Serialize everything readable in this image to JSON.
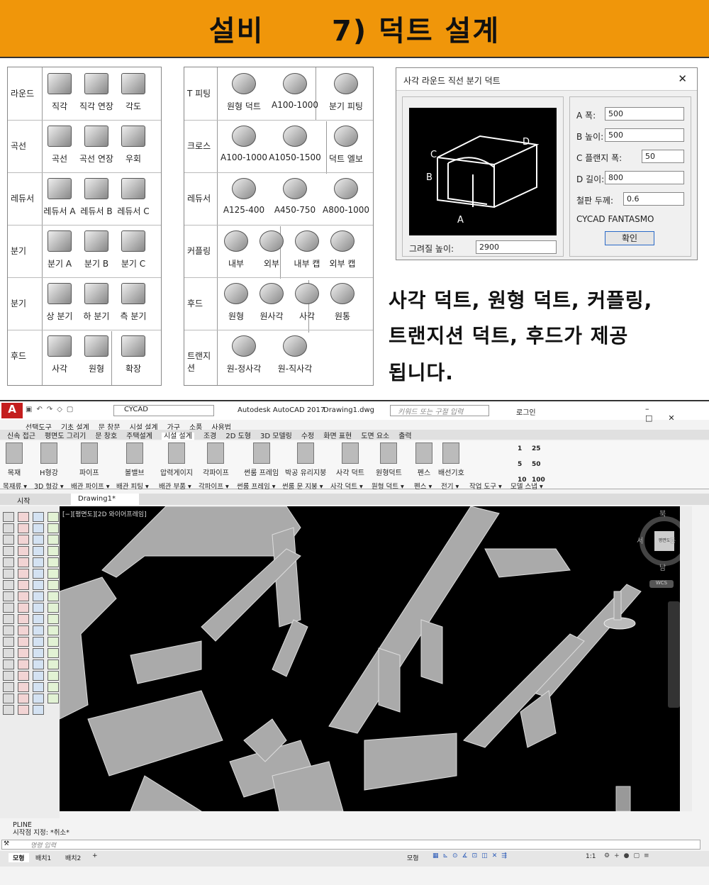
{
  "banner": {
    "title": "설비      7) 덕트 설계"
  },
  "left_panel": {
    "rows": [
      {
        "label": "라운드",
        "items": [
          "직각",
          "직각 연장",
          "각도"
        ]
      },
      {
        "label": "곡선",
        "items": [
          "곡선",
          "곡선 연장",
          "우회"
        ]
      },
      {
        "label": "레듀서",
        "items": [
          "레듀서 A",
          "레듀서 B",
          "레듀서 C"
        ]
      },
      {
        "label": "분기",
        "items": [
          "분기 A",
          "분기 B",
          "분기 C"
        ]
      },
      {
        "label": "분기",
        "items": [
          "상 분기",
          "하 분기",
          "측 분기"
        ]
      },
      {
        "label": "후드",
        "items": [
          "사각",
          "원형",
          "확장"
        ]
      }
    ]
  },
  "mid_panel": {
    "rows": [
      {
        "label": "T 피팅",
        "items": [
          "원형 덕트",
          "A100-1000",
          "분기 피팅"
        ]
      },
      {
        "label": "크로스",
        "items": [
          "A100-1000",
          "A1050-1500",
          "덕트 엘보"
        ]
      },
      {
        "label": "레듀서",
        "items": [
          "A125-400",
          "A450-750",
          "A800-1000"
        ]
      },
      {
        "label": "커플링",
        "items": [
          "내부",
          "외부",
          "내부 캡",
          "외부 캡"
        ]
      },
      {
        "label": "후드",
        "items": [
          "원형",
          "원사각",
          "사각",
          "원통"
        ]
      },
      {
        "label": "트랜지션",
        "items": [
          "원-정사각",
          "원-직사각"
        ]
      }
    ]
  },
  "dialog": {
    "title": "사각 라운드 직선 분기 덕트",
    "close": "✕",
    "fields": [
      {
        "label": "A 폭:",
        "value": "500"
      },
      {
        "label": "B 높이:",
        "value": "500"
      },
      {
        "label": "C 플랜지 폭:",
        "value": "50"
      },
      {
        "label": "D 길이:",
        "value": "800"
      },
      {
        "label": "철판 두께:",
        "value": "0.6"
      }
    ],
    "brand": "CYCAD FANTASMO",
    "ok": "확인",
    "draw_height_label": "그려질 높이:",
    "draw_height_value": "2900",
    "preview_labels": {
      "a": "A",
      "b": "B",
      "c": "C",
      "d": "D"
    }
  },
  "description": [
    "사각 덕트, 원형 덕트, 커플링,",
    "트랜지션 덕트, 후드가 제공",
    "됩니다."
  ],
  "autocad": {
    "app_title": "Autodesk AutoCAD 2017",
    "doc_title": "Drawing1.dwg",
    "workspace": "CYCAD",
    "search_placeholder": "키워드 또는 구절 입력",
    "login": "로그인",
    "menu": [
      "선택도구",
      "기초 설계",
      "문 창문",
      "시설 설계",
      "가구",
      "소품",
      "사용법"
    ],
    "ribbon_tabs": [
      "신속 접근",
      "평면도 그리기",
      "문 창호",
      "주택설계",
      "시설 설계",
      "조경",
      "2D 도형",
      "3D 모델링",
      "수정",
      "화면 표현",
      "도면 요소",
      "출력"
    ],
    "tools": [
      "목재",
      "H형강",
      "파이프",
      "볼밸브",
      "압력게이지",
      "각파이프",
      "썬룸 프레임",
      "박공 유리지붕",
      "사각 덕트",
      "원형덕트",
      "펜스",
      "배선기호"
    ],
    "scale_labels": [
      "1",
      "25",
      "5",
      "50",
      "10",
      "100"
    ],
    "sub_labels": [
      "목재류 ▾",
      "3D 형강 ▾",
      "배관 파이프 ▾",
      "배관 피팅 ▾",
      "배관 부품 ▾",
      "각파이프 ▾",
      "썬룸 프레임 ▾",
      "썬룸 문 지붕 ▾",
      "사각 덕트 ▾",
      "원형 덕트 ▾",
      "펜스 ▾",
      "전기 ▾",
      "작업 도구 ▾",
      "모델 스냅 ▾"
    ],
    "doc_tabs": [
      "시작",
      "Drawing1*"
    ],
    "viewport_label": "[−][평면도][2D 와이어프레임]",
    "compass": {
      "n": "북",
      "s": "남",
      "e": "동",
      "w": "서",
      "center": "평면도",
      "wcs": "WCS"
    },
    "command_history": [
      "PLINE",
      "시작점 지정: *취소*"
    ],
    "command_placeholder": "명령 입력",
    "layout_tabs": [
      "모형",
      "배치1",
      "배치2"
    ],
    "status": {
      "model": "모형",
      "scale": "1:1"
    }
  }
}
